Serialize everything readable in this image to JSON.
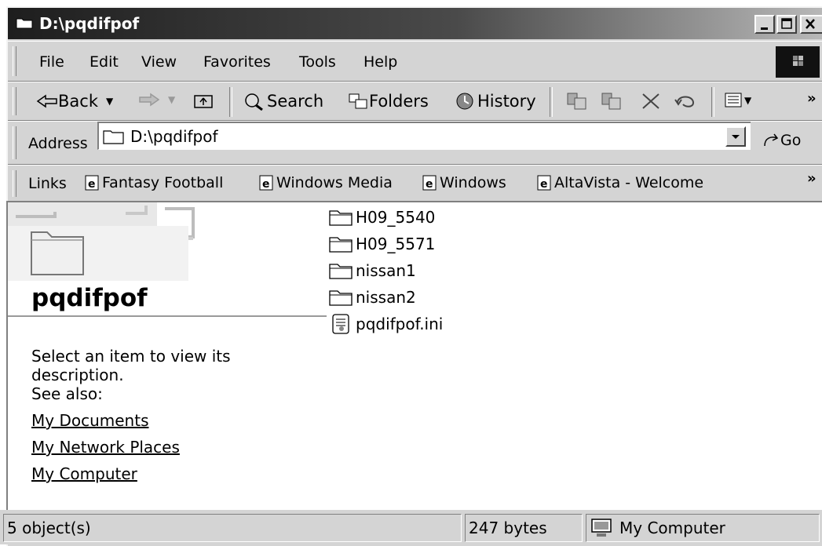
{
  "window": {
    "title": "D:\\pqdifpof"
  },
  "menu": [
    "File",
    "Edit",
    "View",
    "Favorites",
    "Tools",
    "Help"
  ],
  "toolbar": {
    "back": "Back",
    "search": "Search",
    "folders": "Folders",
    "history": "History"
  },
  "address": {
    "label": "Address",
    "value": "D:\\pqdifpof",
    "go": "Go"
  },
  "links": {
    "label": "Links",
    "items": [
      "Fantasy Football",
      "Windows Media",
      "Windows",
      "AltaVista - Welcome"
    ]
  },
  "webview": {
    "folder_name": "pqdifpof",
    "description": "Select an item to view its description.",
    "see_also": "See also:",
    "see_also_links": [
      "My Documents",
      "My Network Places",
      "My Computer"
    ]
  },
  "files": [
    {
      "name": "H09_5540",
      "type": "folder"
    },
    {
      "name": "H09_5571",
      "type": "folder"
    },
    {
      "name": "nissan1",
      "type": "folder"
    },
    {
      "name": "nissan2",
      "type": "folder"
    },
    {
      "name": "pqdifpof.ini",
      "type": "ini"
    }
  ],
  "status": {
    "objects": "5 object(s)",
    "size": "247 bytes",
    "zone": "My Computer"
  }
}
